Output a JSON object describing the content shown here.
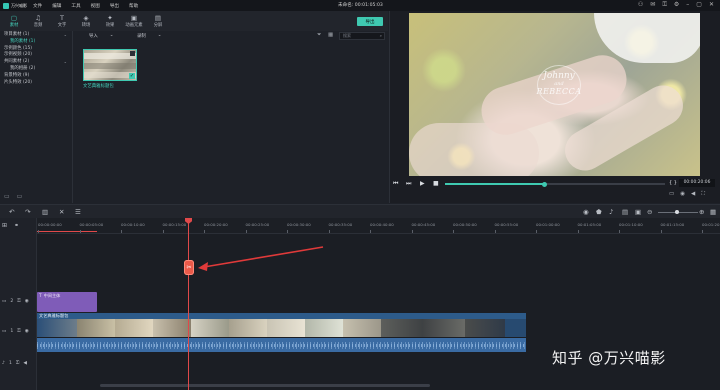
{
  "menubar": {
    "logo": "万兴喵影",
    "items": [
      "文件",
      "编辑",
      "工具",
      "视图",
      "导出",
      "帮助"
    ],
    "project_title": "未命名: 00:01:05:03"
  },
  "tabs": [
    {
      "icon": "▢",
      "label": "素材"
    },
    {
      "icon": "♫",
      "label": "音频"
    },
    {
      "icon": "T",
      "label": "文字"
    },
    {
      "icon": "◈",
      "label": "转场"
    },
    {
      "icon": "✦",
      "label": "效果"
    },
    {
      "icon": "▣",
      "label": "动画元素"
    },
    {
      "icon": "▤",
      "label": "分屏"
    }
  ],
  "export_label": "导出",
  "tree": [
    {
      "label": "项目素材 (1)",
      "indent": false,
      "chev": "⌄",
      "selected": false
    },
    {
      "label": "我的素材 (1)",
      "indent": true,
      "chev": "",
      "selected": true
    },
    {
      "label": "示例颜色 (15)",
      "indent": false,
      "chev": "",
      "selected": false
    },
    {
      "label": "示例视频 (20)",
      "indent": false,
      "chev": "",
      "selected": false
    },
    {
      "label": "共同素材 (2)",
      "indent": false,
      "chev": "⌄",
      "selected": false
    },
    {
      "label": "我的相册 (2)",
      "indent": true,
      "chev": "",
      "selected": false
    },
    {
      "label": "背景特效 (9)",
      "indent": false,
      "chev": "",
      "selected": false
    },
    {
      "label": "片头特效 (20)",
      "indent": false,
      "chev": "",
      "selected": false
    }
  ],
  "media": {
    "import_label": "导入",
    "record_label": "录制",
    "search_placeholder": "搜索",
    "clip_name": "文艺典雅标题包"
  },
  "preview": {
    "overlay_name1": "Johnny",
    "overlay_amp": "and",
    "overlay_name2": "REBECCA",
    "timecode": "00:00:20:06",
    "progress": 0.45
  },
  "ruler_labels": [
    "00:00:00:00",
    "00:00:05:00",
    "00:00:10:00",
    "00:00:15:00",
    "00:00:20:00",
    "00:00:25:00",
    "00:00:30:00",
    "00:00:35:00",
    "00:00:40:00",
    "00:00:45:00",
    "00:00:50:00",
    "00:00:55:00",
    "00:01:00:00",
    "00:01:05:00",
    "00:01:10:00",
    "00:01:15:00",
    "00:01:20:00"
  ],
  "tracks": {
    "title_track": "2",
    "video_track": "1",
    "audio_track": "1",
    "title_clip": "中间主体",
    "video_clip": "文艺典雅标题包"
  },
  "watermark": "知乎 @万兴喵影"
}
